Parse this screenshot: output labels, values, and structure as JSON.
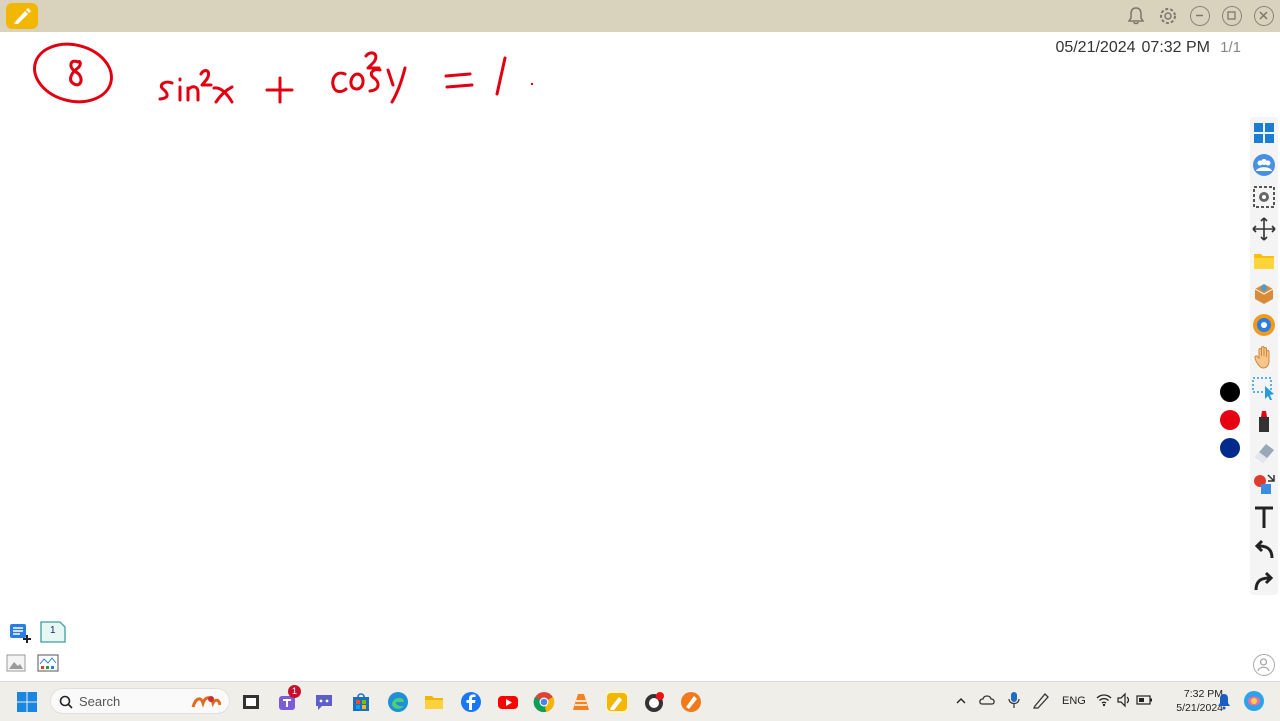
{
  "titlebar": {
    "icons": [
      "pen-icon",
      "bell-icon",
      "gear-icon",
      "minimize-icon",
      "restore-icon",
      "close-icon"
    ]
  },
  "header": {
    "date": "05/21/2024",
    "time": "07:32 PM",
    "page": "1/1"
  },
  "board": {
    "ink_color": "#e00010"
  },
  "toolbar": {
    "tools": [
      "windows-grid-icon",
      "people-icon",
      "screenshot-icon",
      "move-icon",
      "folder-icon",
      "box-icon",
      "browser-icon",
      "hand-icon",
      "select-icon",
      "marker-icon",
      "eraser-icon",
      "shapes-icon",
      "text-icon",
      "undo-icon",
      "redo-icon"
    ],
    "colors": [
      "#000000",
      "#e60012",
      "#002a8c"
    ]
  },
  "pages": {
    "current_page": "1"
  },
  "taskbar": {
    "search_label": "Search",
    "badge_count": "1",
    "language": "ENG",
    "clock_time": "7:32 PM",
    "clock_date": "5/21/2024"
  }
}
